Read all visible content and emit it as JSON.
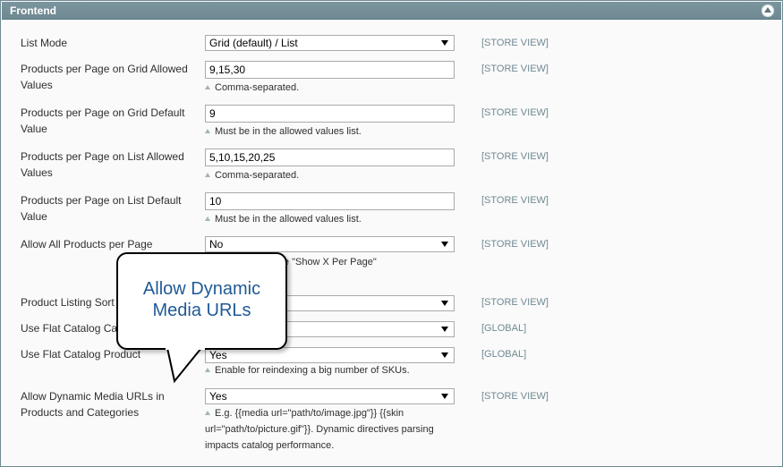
{
  "section": {
    "title": "Frontend",
    "collapse_icon": "chevron-up-circle-icon"
  },
  "fields": [
    {
      "label": "List Mode",
      "type": "select",
      "value": "Grid (default) / List",
      "scope": "[STORE VIEW]",
      "note": ""
    },
    {
      "label": "Products per Page on Grid Allowed Values",
      "type": "text",
      "value": "9,15,30",
      "scope": "[STORE VIEW]",
      "note": "Comma-separated."
    },
    {
      "label": "Products per Page on Grid Default Value",
      "type": "text",
      "value": "9",
      "scope": "[STORE VIEW]",
      "note": "Must be in the allowed values list."
    },
    {
      "label": "Products per Page on List Allowed Values",
      "type": "text",
      "value": "5,10,15,20,25",
      "scope": "[STORE VIEW]",
      "note": "Comma-separated."
    },
    {
      "label": "Products per Page on List Default Value",
      "type": "text",
      "value": "10",
      "scope": "[STORE VIEW]",
      "note": "Must be in the allowed values list."
    },
    {
      "label": "Allow All Products per Page",
      "type": "select",
      "value": "No",
      "scope": "[STORE VIEW]",
      "note": "\"All\" option in the \"Show X Per Page\""
    },
    {
      "label": "Product Listing Sort",
      "type": "select",
      "value": "",
      "scope": "[STORE VIEW]",
      "note": ""
    },
    {
      "label": "Use Flat Catalog Ca",
      "type": "select",
      "value": "",
      "scope": "[GLOBAL]",
      "note": ""
    },
    {
      "label": "Use Flat Catalog Product",
      "type": "select",
      "value": "Yes",
      "scope": "[GLOBAL]",
      "note": "Enable for reindexing a big number of SKUs."
    },
    {
      "label": "Allow Dynamic Media URLs in Products and Categories",
      "type": "select",
      "value": "Yes",
      "scope": "[STORE VIEW]",
      "note": "E.g. {{media url=\"path/to/image.jpg\"}} {{skin url=\"path/to/picture.gif\"}}. Dynamic directives parsing impacts catalog performance."
    }
  ],
  "callout": {
    "text": "Allow Dynamic Media URLs"
  }
}
